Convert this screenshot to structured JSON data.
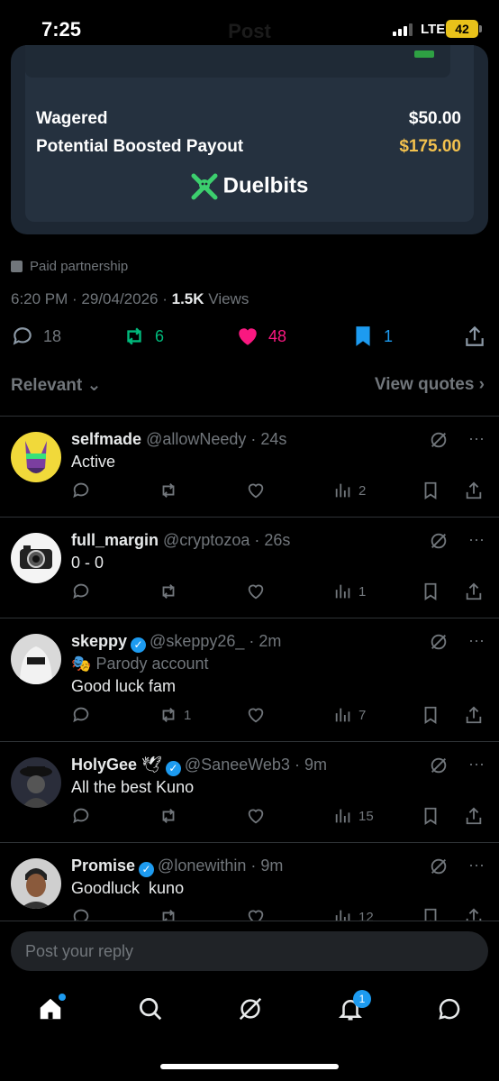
{
  "status": {
    "time": "7:25",
    "network": "LTE",
    "battery": "42",
    "title": "Post"
  },
  "card": {
    "wagered_label": "Wagered",
    "wagered_value": "$50.00",
    "payout_label": "Potential Boosted Payout",
    "payout_value": "$175.00",
    "brand": "Duelbits"
  },
  "post": {
    "paid_label": "Paid partnership",
    "time": "6:20 PM",
    "date": "29/04/2026",
    "views_count": "1.5K",
    "views_label": "Views",
    "replies": "18",
    "reposts": "6",
    "likes": "48",
    "bookmarks": "1"
  },
  "sort": {
    "label": "Relevant",
    "quotes": "View quotes"
  },
  "replies": [
    {
      "name": "selfmade",
      "handle": "@allowNeedy",
      "age": "24s",
      "text": "Active",
      "views": "2",
      "reposts": ""
    },
    {
      "name": "full_margin",
      "handle": "@cryptozoa",
      "age": "26s",
      "text": "0 - 0",
      "views": "1",
      "reposts": ""
    },
    {
      "name": "skeppy",
      "handle": "@skeppy26_",
      "age": "2m",
      "parody": "Parody account",
      "text": "Good luck fam",
      "views": "7",
      "reposts": "1"
    },
    {
      "name": "HolyGee",
      "handle": "@SaneeWeb3",
      "age": "9m",
      "text": "All the best Kuno",
      "views": "15",
      "reposts": ""
    },
    {
      "name": "Promise",
      "handle": "@lonewithin",
      "age": "9m",
      "text": "Goodluck  kuno",
      "views": "12",
      "reposts": ""
    }
  ],
  "composer": {
    "placeholder": "Post your reply"
  },
  "tabs": {
    "notifications_badge": "1"
  },
  "colors": {
    "accent": "#1d9bf0",
    "like": "#f91880",
    "repost": "#00ba7c",
    "gold": "#f2c14e"
  }
}
